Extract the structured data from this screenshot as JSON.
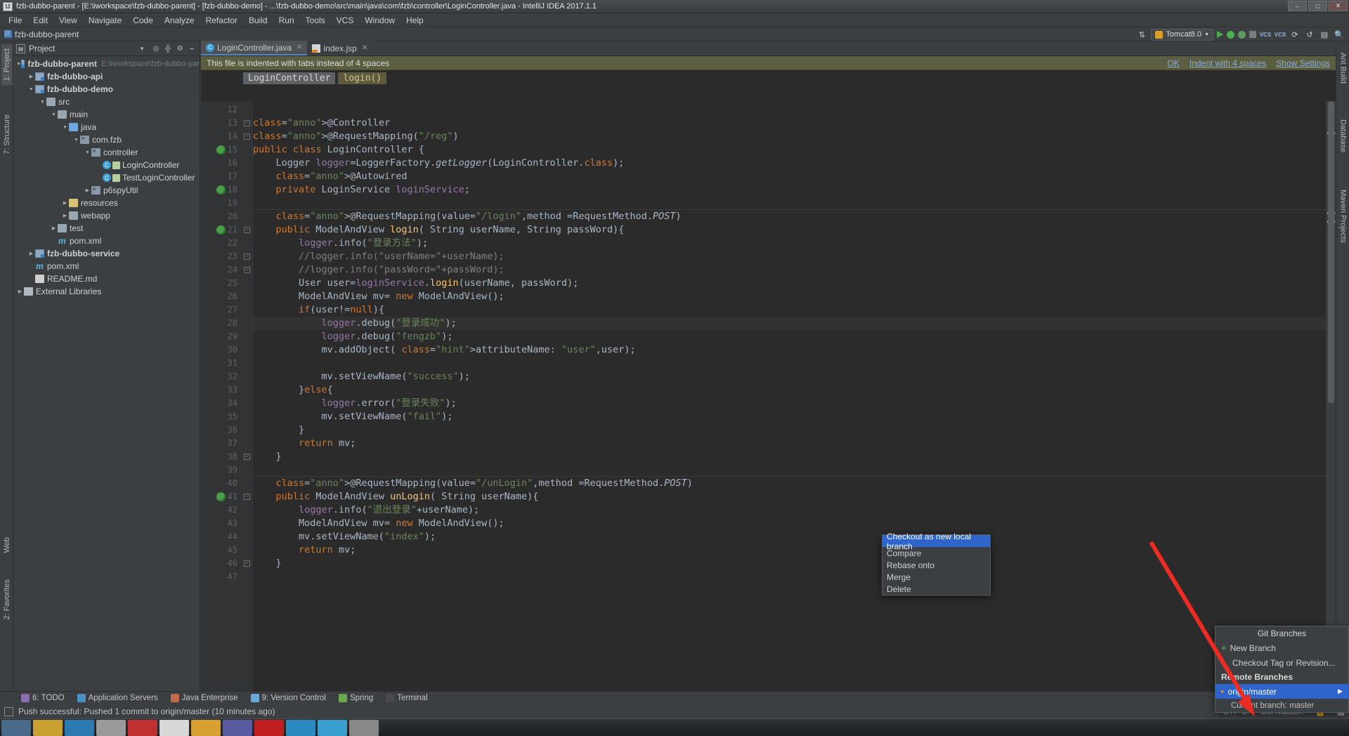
{
  "window": {
    "title": "fzb-dubbo-parent - [E:\\iworkspace\\fzb-dubbo-parent] - [fzb-dubbo-demo] - ...\\fzb-dubbo-demo\\src\\main\\java\\com\\fzb\\controller\\LoginController.java - IntelliJ IDEA 2017.1.1",
    "app_initials": "IJ",
    "minimize": "–",
    "maximize": "□",
    "close": "✕"
  },
  "menu": [
    "File",
    "Edit",
    "View",
    "Navigate",
    "Code",
    "Analyze",
    "Refactor",
    "Build",
    "Run",
    "Tools",
    "VCS",
    "Window",
    "Help"
  ],
  "navbar": {
    "module": "fzb-dubbo-parent"
  },
  "toolbar": {
    "run_config": "Tomcat8.0",
    "icons": [
      "sort-icon",
      "run-icon",
      "debug-icon",
      "coverage-icon",
      "stop-icon",
      "vcs-update-icon",
      "vcs-commit-icon",
      "history-icon",
      "undo-icon",
      "settings-icon",
      "search-icon"
    ]
  },
  "left_tool_strip": [
    {
      "label": "1: Project",
      "selected": true
    },
    {
      "label": "7: Structure",
      "selected": false
    },
    {
      "label": "2: Favorites",
      "selected": false
    },
    {
      "label": "Web",
      "selected": false
    }
  ],
  "right_tool_strip": [
    {
      "label": "Ant Build"
    },
    {
      "label": "Database"
    },
    {
      "label": "Maven Projects"
    }
  ],
  "project_panel": {
    "title": "Project",
    "dropdown_caret": "▼",
    "buttons": [
      "target-icon",
      "collapse-all-icon",
      "settings-icon",
      "hide-icon"
    ],
    "tree": [
      {
        "depth": 0,
        "twisty": "▼",
        "icon": "module",
        "label": "fzb-dubbo-parent",
        "bold": true,
        "hint": "E:\\iworkspace\\fzb-dubbo-par",
        "selected": false
      },
      {
        "depth": 1,
        "twisty": "▶",
        "icon": "module",
        "label": "fzb-dubbo-api",
        "bold": true,
        "hint": "",
        "selected": false
      },
      {
        "depth": 1,
        "twisty": "▼",
        "icon": "module",
        "label": "fzb-dubbo-demo",
        "bold": true,
        "hint": "",
        "selected": false
      },
      {
        "depth": 2,
        "twisty": "▼",
        "icon": "dir",
        "label": "src",
        "bold": false,
        "hint": "",
        "selected": false
      },
      {
        "depth": 3,
        "twisty": "▼",
        "icon": "dir",
        "label": "main",
        "bold": false,
        "hint": "",
        "selected": false
      },
      {
        "depth": 4,
        "twisty": "▼",
        "icon": "java",
        "label": "java",
        "bold": false,
        "hint": "",
        "selected": false
      },
      {
        "depth": 5,
        "twisty": "▼",
        "icon": "pkg",
        "label": "com.fzb",
        "bold": false,
        "hint": "",
        "selected": false
      },
      {
        "depth": 6,
        "twisty": "▼",
        "icon": "pkg",
        "label": "controller",
        "bold": false,
        "hint": "",
        "selected": false
      },
      {
        "depth": 7,
        "twisty": "",
        "icon": "class",
        "label": "LoginController",
        "bold": false,
        "hint": "",
        "selected": false
      },
      {
        "depth": 7,
        "twisty": "",
        "icon": "class",
        "label": "TestLoginController",
        "bold": false,
        "hint": "",
        "selected": false
      },
      {
        "depth": 6,
        "twisty": "▶",
        "icon": "pkg",
        "label": "p6spyUtil",
        "bold": false,
        "hint": "",
        "selected": false
      },
      {
        "depth": 4,
        "twisty": "▶",
        "icon": "res",
        "label": "resources",
        "bold": false,
        "hint": "",
        "selected": false
      },
      {
        "depth": 4,
        "twisty": "▶",
        "icon": "dir",
        "label": "webapp",
        "bold": false,
        "hint": "",
        "selected": false
      },
      {
        "depth": 3,
        "twisty": "▶",
        "icon": "test",
        "label": "test",
        "bold": false,
        "hint": "",
        "selected": false
      },
      {
        "depth": 3,
        "twisty": "",
        "icon": "maven",
        "label": "pom.xml",
        "bold": false,
        "hint": "",
        "selected": false
      },
      {
        "depth": 1,
        "twisty": "▶",
        "icon": "module",
        "label": "fzb-dubbo-service",
        "bold": true,
        "hint": "",
        "selected": false
      },
      {
        "depth": 1,
        "twisty": "",
        "icon": "maven",
        "label": "pom.xml",
        "bold": false,
        "hint": "",
        "selected": false
      },
      {
        "depth": 1,
        "twisty": "",
        "icon": "md",
        "label": "README.md",
        "bold": false,
        "hint": "",
        "selected": false
      },
      {
        "depth": 0,
        "twisty": "▶",
        "icon": "lib",
        "label": "External Libraries",
        "bold": false,
        "hint": "",
        "selected": false
      }
    ]
  },
  "editor": {
    "tabs": [
      {
        "label": "LoginController.java",
        "icon": "java-class-icon",
        "active": true,
        "close": "✕"
      },
      {
        "label": "index.jsp",
        "icon": "jsp-icon",
        "active": false,
        "close": "✕"
      }
    ],
    "notification": {
      "message": "This file is indented with tabs instead of 4 spaces",
      "links": [
        "OK",
        "Indent with 4 spaces",
        "Show Settings"
      ]
    },
    "breadcrumbs": [
      {
        "label": "LoginController",
        "style": "one"
      },
      {
        "label": "login()",
        "style": "two"
      }
    ],
    "first_line_number": 12,
    "lines": [
      {
        "n": 12,
        "text": "",
        "marker": "",
        "fold": ""
      },
      {
        "n": 13,
        "text": "@Controller",
        "marker": "",
        "fold": "minus"
      },
      {
        "n": 14,
        "text": "@RequestMapping(\"/reg\")",
        "marker": "",
        "fold": "minus"
      },
      {
        "n": 15,
        "text": "public class LoginController {",
        "marker": "bean",
        "fold": ""
      },
      {
        "n": 16,
        "text": "    Logger logger=LoggerFactory.getLogger(LoginController.class);",
        "marker": "",
        "fold": ""
      },
      {
        "n": 17,
        "text": "    @Autowired",
        "marker": "",
        "fold": ""
      },
      {
        "n": 18,
        "text": "    private LoginService loginService;",
        "marker": "bean-arrow",
        "fold": ""
      },
      {
        "n": 19,
        "text": "",
        "marker": "",
        "fold": ""
      },
      {
        "n": 20,
        "text": "    @RequestMapping(value=\"/login\",method =RequestMethod.POST)",
        "marker": "",
        "fold": ""
      },
      {
        "n": 21,
        "text": "    public ModelAndView login( String userName, String passWord){",
        "marker": "bean",
        "fold": "minus"
      },
      {
        "n": 22,
        "text": "        logger.info(\"登录方法\");",
        "marker": "",
        "fold": ""
      },
      {
        "n": 23,
        "text": "        //logger.info(\"userName=\"+userName);",
        "marker": "",
        "fold": "minus"
      },
      {
        "n": 24,
        "text": "        //logger.info(\"passWord=\"+passWord);",
        "marker": "",
        "fold": "end"
      },
      {
        "n": 25,
        "text": "        User user=loginService.login(userName, passWord);",
        "marker": "",
        "fold": ""
      },
      {
        "n": 26,
        "text": "        ModelAndView mv= new ModelAndView();",
        "marker": "",
        "fold": ""
      },
      {
        "n": 27,
        "text": "        if(user!=null){",
        "marker": "",
        "fold": ""
      },
      {
        "n": 28,
        "text": "            logger.debug(\"登录成功\");",
        "marker": "",
        "fold": ""
      },
      {
        "n": 29,
        "text": "            logger.debug(\"fengzb\");",
        "marker": "",
        "fold": ""
      },
      {
        "n": 30,
        "text": "            mv.addObject( attributeName: \"user\",user);",
        "marker": "",
        "fold": ""
      },
      {
        "n": 31,
        "text": "",
        "marker": "",
        "fold": ""
      },
      {
        "n": 32,
        "text": "            mv.setViewName(\"success\");",
        "marker": "",
        "fold": ""
      },
      {
        "n": 33,
        "text": "        }else{",
        "marker": "",
        "fold": ""
      },
      {
        "n": 34,
        "text": "            logger.error(\"登录失败\");",
        "marker": "",
        "fold": ""
      },
      {
        "n": 35,
        "text": "            mv.setViewName(\"fail\");",
        "marker": "",
        "fold": ""
      },
      {
        "n": 36,
        "text": "        }",
        "marker": "",
        "fold": ""
      },
      {
        "n": 37,
        "text": "        return mv;",
        "marker": "",
        "fold": ""
      },
      {
        "n": 38,
        "text": "    }",
        "marker": "",
        "fold": "end"
      },
      {
        "n": 39,
        "text": "",
        "marker": "",
        "fold": ""
      },
      {
        "n": 40,
        "text": "    @RequestMapping(value=\"/unLogin\",method =RequestMethod.POST)",
        "marker": "",
        "fold": ""
      },
      {
        "n": 41,
        "text": "    public ModelAndView unLogin( String userName){",
        "marker": "bean",
        "fold": "minus"
      },
      {
        "n": 42,
        "text": "        logger.info(\"退出登录\"+userName);",
        "marker": "",
        "fold": ""
      },
      {
        "n": 43,
        "text": "        ModelAndView mv= new ModelAndView();",
        "marker": "",
        "fold": ""
      },
      {
        "n": 44,
        "text": "        mv.setViewName(\"index\");",
        "marker": "",
        "fold": ""
      },
      {
        "n": 45,
        "text": "        return mv;",
        "marker": "",
        "fold": ""
      },
      {
        "n": 46,
        "text": "    }",
        "marker": "",
        "fold": "end"
      },
      {
        "n": 47,
        "text": "",
        "marker": "",
        "fold": ""
      }
    ],
    "highlighted_line": 28
  },
  "git_popup": {
    "title": "Git Branches",
    "new_branch": "New Branch",
    "new_branch_icon": "+",
    "checkout_tag": "Checkout Tag or Revision...",
    "remote_section": "Remote Branches",
    "remote_branch": "origin/master",
    "remote_branch_arrow": "▶",
    "current_branch": "Current branch: master"
  },
  "context_menu": {
    "items": [
      {
        "label": "Checkout as new local branch",
        "selected": true
      },
      {
        "label": "Compare",
        "selected": false
      },
      {
        "label": "Rebase onto",
        "selected": false
      },
      {
        "label": "Merge",
        "selected": false
      },
      {
        "label": "Delete",
        "selected": false
      }
    ]
  },
  "bottom_tools": [
    {
      "label": "6: TODO",
      "icon": "todo-icon",
      "color": "#8b6fb0"
    },
    {
      "label": "Application Servers",
      "icon": "servers-icon",
      "color": "#4a90c4"
    },
    {
      "label": "Java Enterprise",
      "icon": "java-ee-icon",
      "color": "#c46a4a"
    },
    {
      "label": "9: Version Control",
      "icon": "vcs-icon",
      "color": "#6aa8d8"
    },
    {
      "label": "Spring",
      "icon": "spring-icon",
      "color": "#6aa84f"
    },
    {
      "label": "Terminal",
      "icon": "terminal-icon",
      "color": "#4a4a4a"
    }
  ],
  "status_bar": {
    "message": "Push successful: Pushed 1 commit to origin/master (10 minutes ago)",
    "encoding": "UTF-8",
    "encoding_caret": "⁞",
    "git": "Git: master",
    "git_caret": "⁞",
    "lock_icon": "lock-icon",
    "inspect_icon": "inspection-icon"
  },
  "taskbar": {
    "apps": [
      "#4a6a8a",
      "#c8a030",
      "#2a7ab0",
      "#9a9a9a",
      "#c03030",
      "#d8d8d8",
      "#d8a030",
      "#5a5aa0",
      "#c02020",
      "#2a8ac0",
      "#3aa0d0",
      "#888888"
    ]
  },
  "colors": {
    "accent": "#2f65ca",
    "notification_bg": "#5b5e41",
    "editor_bg": "#2b2b2b",
    "panel_bg": "#3c3f41",
    "arrow_red": "#ee2b22"
  }
}
